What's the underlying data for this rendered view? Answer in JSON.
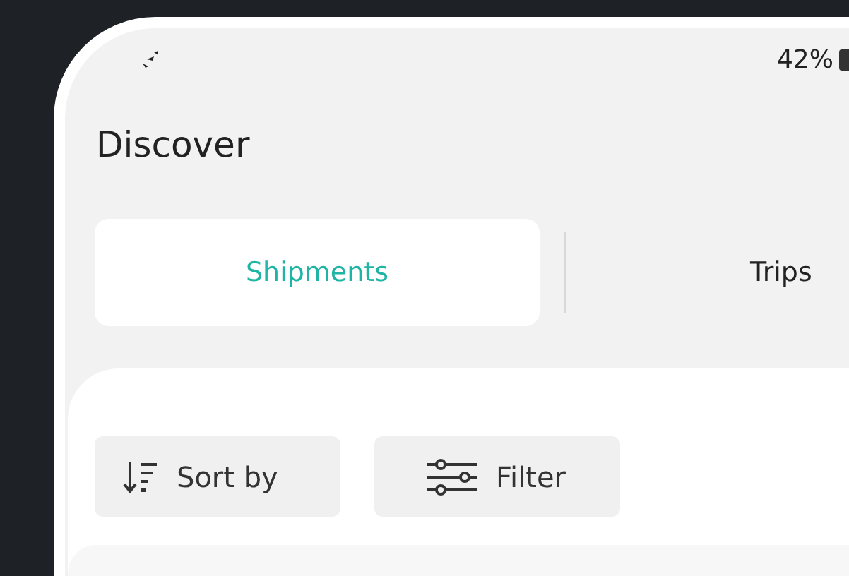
{
  "status_bar": {
    "battery": "42%"
  },
  "title": "Discover",
  "tabs": [
    {
      "label": "Shipments",
      "selected": true
    },
    {
      "label": "Trips",
      "selected": false
    }
  ],
  "actions": [
    {
      "kind": "sort",
      "label": "Sort by"
    },
    {
      "kind": "filter",
      "label": "Filter"
    }
  ]
}
